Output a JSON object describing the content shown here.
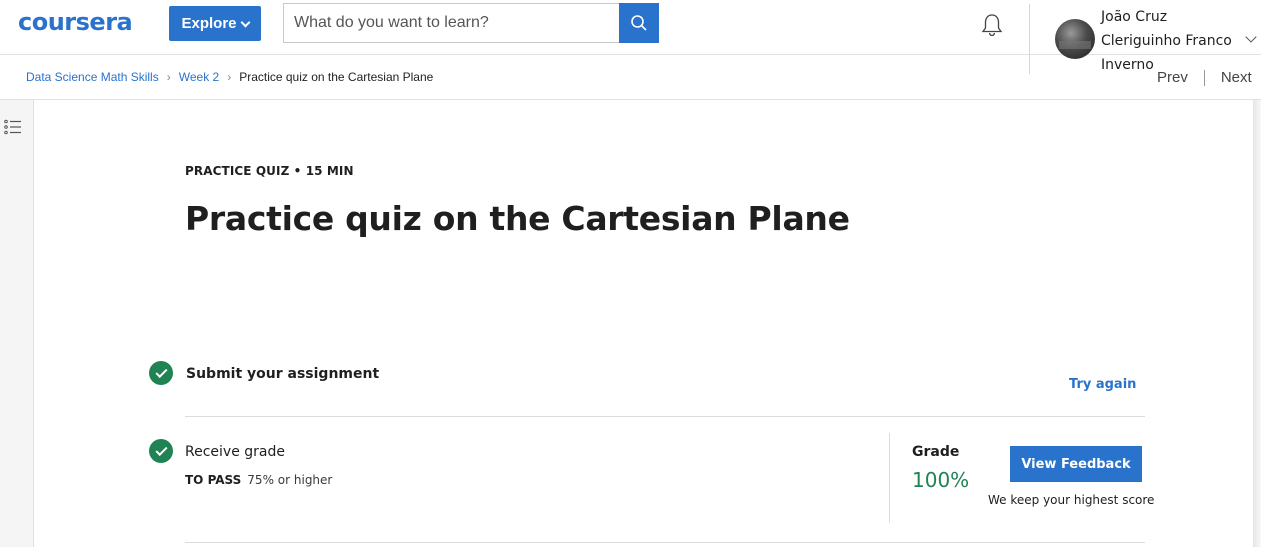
{
  "header": {
    "logo_text": "coursera",
    "explore_label": "Explore",
    "search_placeholder": "What do you want to learn?",
    "user_name": "João Cruz Clériguinho Franco Inverno",
    "user_name_display": "João Cruz Cleriguinho Franco Inverno"
  },
  "breadcrumb": {
    "items": [
      "Data Science Math Skills",
      "Week 2"
    ],
    "current": "Practice quiz on the Cartesian Plane"
  },
  "nav": {
    "prev": "Prev",
    "next": "Next"
  },
  "quiz": {
    "kicker": "PRACTICE QUIZ • 15 MIN",
    "title": "Practice quiz on the Cartesian Plane"
  },
  "steps": {
    "submit": {
      "label": "Submit your assignment",
      "action": "Try again"
    },
    "receive": {
      "label": "Receive grade",
      "to_pass_label": "TO PASS",
      "to_pass_value": "75% or higher",
      "grade_label": "Grade",
      "grade_value": "100%",
      "feedback_button": "View Feedback",
      "note": "We keep your highest score"
    }
  },
  "colors": {
    "brand": "#2a73cc",
    "success": "#1f8354"
  },
  "icons": [
    "search-icon",
    "bell-icon",
    "chevron-down-icon",
    "list-icon",
    "check-icon"
  ]
}
